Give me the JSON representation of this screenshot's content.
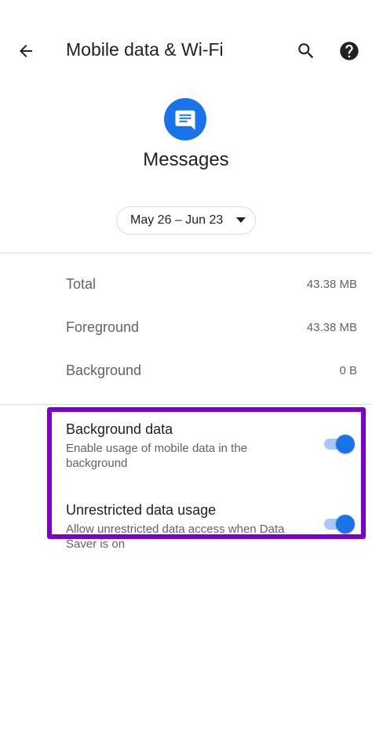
{
  "header": {
    "title": "Mobile data & Wi-Fi",
    "back_icon": "arrow-back-icon",
    "search_icon": "search-icon",
    "help_icon": "help-icon"
  },
  "app": {
    "name": "Messages",
    "icon": "messages-app-icon",
    "icon_color": "#1a73e8"
  },
  "date_range": {
    "label": "May 26 – Jun 23",
    "icon": "dropdown-arrow-icon"
  },
  "usage": [
    {
      "label": "Total",
      "value": "43.38 MB"
    },
    {
      "label": "Foreground",
      "value": "43.38 MB"
    },
    {
      "label": "Background",
      "value": "0 B"
    }
  ],
  "settings": [
    {
      "title": "Background data",
      "summary": "Enable usage of mobile data in the background",
      "enabled": true
    },
    {
      "title": "Unrestricted data usage",
      "summary": "Allow unrestricted data access when Data Saver is on",
      "enabled": true
    }
  ],
  "colors": {
    "accent": "#1a73e8",
    "switch_track_on": "#a8c7fa",
    "highlight_border": "#7b00cc"
  }
}
